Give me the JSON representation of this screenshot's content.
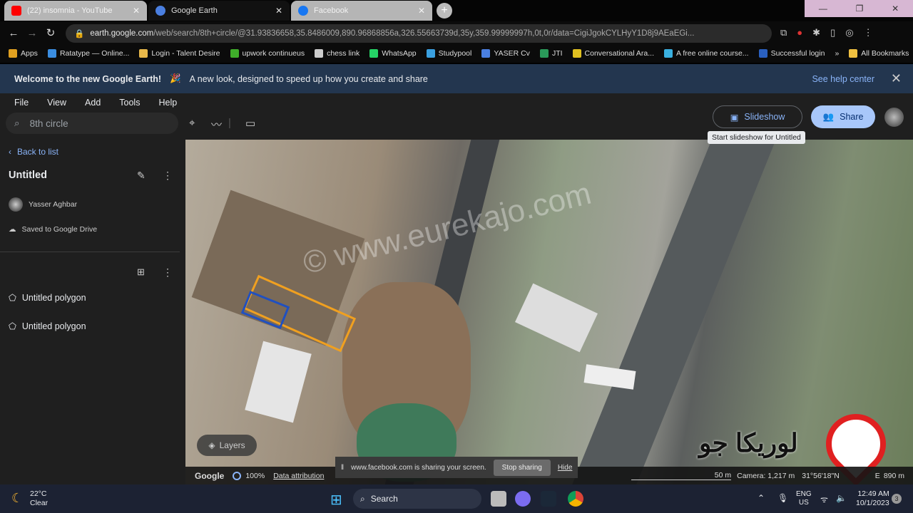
{
  "browser": {
    "tabs": [
      {
        "title": "(22) insomnia - YouTube",
        "favicon": "youtube-icon",
        "color": "#ff0000"
      },
      {
        "title": "Google Earth",
        "favicon": "google-earth-icon",
        "color": "#4a7fe0"
      },
      {
        "title": "Facebook",
        "favicon": "facebook-icon",
        "color": "#1877f2"
      }
    ],
    "url_host": "earth.google.com",
    "url_path": "/web/search/8th+circle/@31.93836658,35.8486009,890.96868856a,326.55663739d,35y,359.99999997h,0t,0r/data=CigiJgokCYLHyY1D8j9AEaEGi...",
    "bookmarks": [
      {
        "label": "Apps",
        "color": "#e0a020"
      },
      {
        "label": "Ratatype — Online...",
        "color": "#3a8de0"
      },
      {
        "label": "Login - Talent Desire",
        "color": "#e8b84a"
      },
      {
        "label": "upwork continueus",
        "color": "#3fae2a"
      },
      {
        "label": "chess link",
        "color": "#cccccc"
      },
      {
        "label": "WhatsApp",
        "color": "#25d366"
      },
      {
        "label": "Studypool",
        "color": "#3aa0e0"
      },
      {
        "label": "YASER Cv",
        "color": "#4a7fe0"
      },
      {
        "label": "JTI",
        "color": "#2a9a5a"
      },
      {
        "label": "Conversational Ara...",
        "color": "#e0c020"
      },
      {
        "label": "A free online course...",
        "color": "#3ab0e0"
      },
      {
        "label": "Successful login",
        "color": "#2a60c0"
      }
    ],
    "more": "»",
    "all_bookmarks": "All Bookmarks"
  },
  "banner": {
    "title": "Welcome to the new Google Earth!",
    "emoji": "🎉",
    "text": "A new look, designed to speed up how you create and share",
    "help": "See help center",
    "close": "✕"
  },
  "menu": [
    "File",
    "View",
    "Add",
    "Tools",
    "Help"
  ],
  "search": {
    "value": "8th circle"
  },
  "toolbar": {
    "slideshow": "Slideshow",
    "share": "Share",
    "tooltip": "Start slideshow for Untitled"
  },
  "panel": {
    "back": "Back to list",
    "project_title": "Untitled",
    "user": "Yasser Aghbar",
    "saved": "Saved to Google Drive",
    "items": [
      "Untitled polygon",
      "Untitled polygon"
    ]
  },
  "map": {
    "watermark": "© www.eurekajo.com",
    "layers": "Layers",
    "logo_text": "لوريكا جو",
    "brand_color": "#e02020",
    "polygon_colors": [
      "#f0a020",
      "#2050c0"
    ]
  },
  "status": {
    "google": "Google",
    "zoom": "100%",
    "attribution": "Data attribution",
    "scale": "50 m",
    "camera": "Camera: 1,217 m",
    "coords": "31°56'18\"N",
    "coords_e": "E",
    "elevation": "890 m"
  },
  "screen_share": {
    "text": "www.facebook.com is sharing your screen.",
    "stop": "Stop sharing",
    "hide": "Hide"
  },
  "taskbar": {
    "temp": "22°C",
    "weather": "Clear",
    "search": "Search",
    "lang1": "ENG",
    "lang2": "US",
    "time": "12:49 AM",
    "date": "10/1/2023",
    "badge": "3"
  }
}
